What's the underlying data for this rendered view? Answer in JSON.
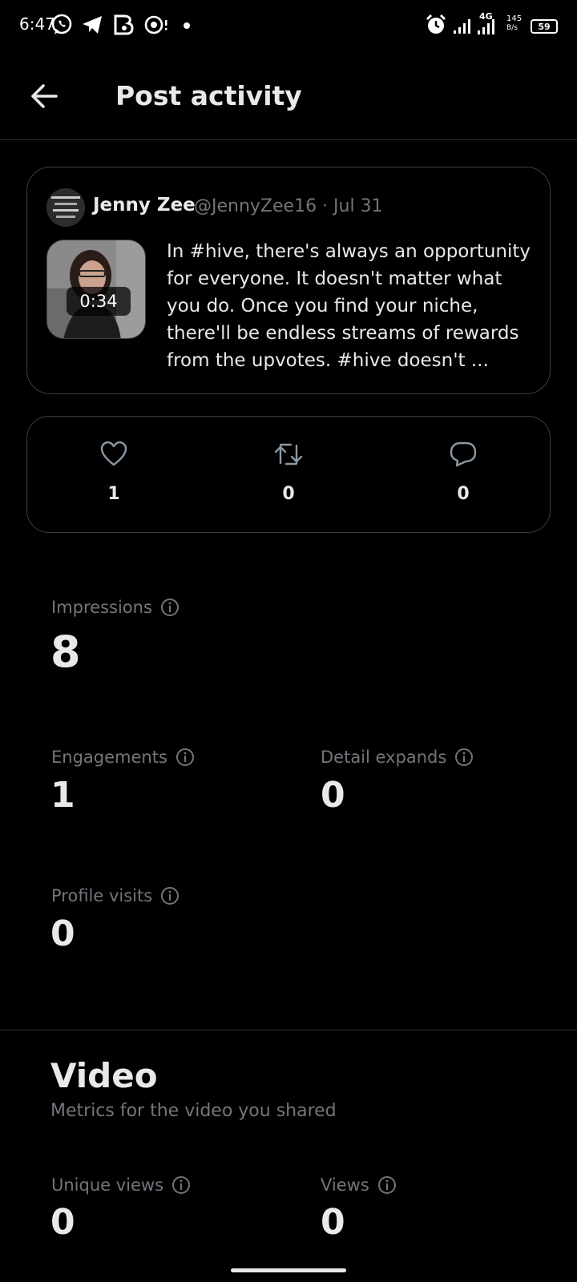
{
  "status_bar": {
    "time": "6:47",
    "network": "4G",
    "speed_top": "145",
    "speed_bottom": "B/s",
    "battery": "59"
  },
  "header": {
    "back_icon": "arrow-left-icon",
    "title": "Post activity"
  },
  "post": {
    "author_name": "Jenny Zee",
    "author_meta": "@JennyZee16 · Jul 31",
    "video_duration": "0:34",
    "text": "In #hive, there's always an opportunity for everyone. It doesn't matter what you do. Once you find your niche, there'll be endless streams of rewards from the upvotes. #hive doesn't ..."
  },
  "engagement": {
    "likes": "1",
    "reposts": "0",
    "replies": "0"
  },
  "metrics": {
    "impressions_label": "Impressions",
    "impressions_value": "8",
    "engagements_label": "Engagements",
    "engagements_value": "1",
    "detail_expands_label": "Detail expands",
    "detail_expands_value": "0",
    "profile_visits_label": "Profile visits",
    "profile_visits_value": "0"
  },
  "video_section": {
    "title": "Video",
    "subtitle": "Metrics for the video you shared",
    "unique_views_label": "Unique views",
    "unique_views_value": "0",
    "views_label": "Views",
    "views_value": "0"
  },
  "colors": {
    "background": "#000000",
    "text_primary": "#e7e9ea",
    "text_secondary": "#71767b",
    "border": "#2f3336"
  }
}
